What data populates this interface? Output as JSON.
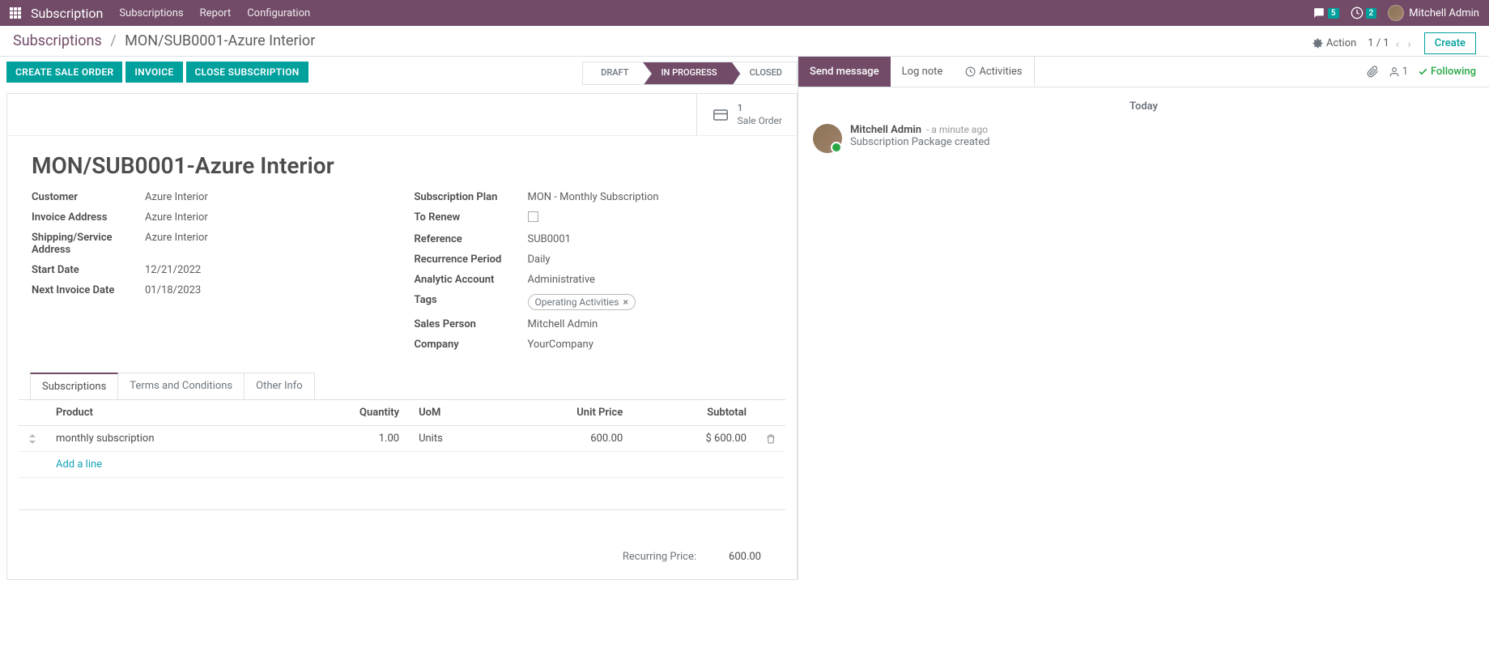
{
  "app": {
    "title": "Subscription"
  },
  "nav": {
    "items": [
      "Subscriptions",
      "Report",
      "Configuration"
    ],
    "messages_count": "5",
    "activities_count": "2",
    "user": "Mitchell Admin"
  },
  "breadcrumb": {
    "root": "Subscriptions",
    "current": "MON/SUB0001-Azure Interior"
  },
  "cp": {
    "action_label": "Action",
    "pager": "1 / 1",
    "create_label": "Create"
  },
  "action_buttons": {
    "create_sale": "CREATE SALE ORDER",
    "invoice": "INVOICE",
    "close": "CLOSE SUBSCRIPTION"
  },
  "statusbar": [
    "DRAFT",
    "IN PROGRESS",
    "CLOSED"
  ],
  "stat": {
    "count": "1",
    "label": "Sale Order"
  },
  "record": {
    "title": "MON/SUB0001-Azure Interior",
    "labels": {
      "customer": "Customer",
      "invoice_addr": "Invoice Address",
      "shipping": "Shipping/Service Address",
      "start_date": "Start Date",
      "next_invoice": "Next Invoice Date",
      "plan": "Subscription Plan",
      "to_renew": "To Renew",
      "reference": "Reference",
      "recurrence": "Recurrence Period",
      "analytic": "Analytic Account",
      "tags": "Tags",
      "sales_person": "Sales Person",
      "company": "Company"
    },
    "values": {
      "customer": "Azure Interior",
      "invoice_addr": "Azure Interior",
      "shipping": "Azure Interior",
      "start_date": "12/21/2022",
      "next_invoice": "01/18/2023",
      "plan": "MON - Monthly Subscription",
      "reference": "SUB0001",
      "recurrence": "Daily",
      "analytic": "Administrative",
      "sales_person": "Mitchell Admin",
      "company": "YourCompany"
    },
    "tag": "Operating Activities"
  },
  "tabs": [
    "Subscriptions",
    "Terms and Conditions",
    "Other Info"
  ],
  "table": {
    "headers": {
      "product": "Product",
      "qty": "Quantity",
      "uom": "UoM",
      "unit_price": "Unit Price",
      "subtotal": "Subtotal"
    },
    "row": {
      "product": "monthly subscription",
      "qty": "1.00",
      "uom": "Units",
      "unit_price": "600.00",
      "subtotal": "$ 600.00"
    },
    "add_line": "Add a line"
  },
  "totals": {
    "label": "Recurring Price:",
    "value": "600.00"
  },
  "chatter": {
    "send": "Send message",
    "log": "Log note",
    "activities": "Activities",
    "followers_count": "1",
    "following": "Following",
    "date": "Today",
    "msg": {
      "author": "Mitchell Admin",
      "time": "- a minute ago",
      "text": "Subscription Package created"
    }
  }
}
